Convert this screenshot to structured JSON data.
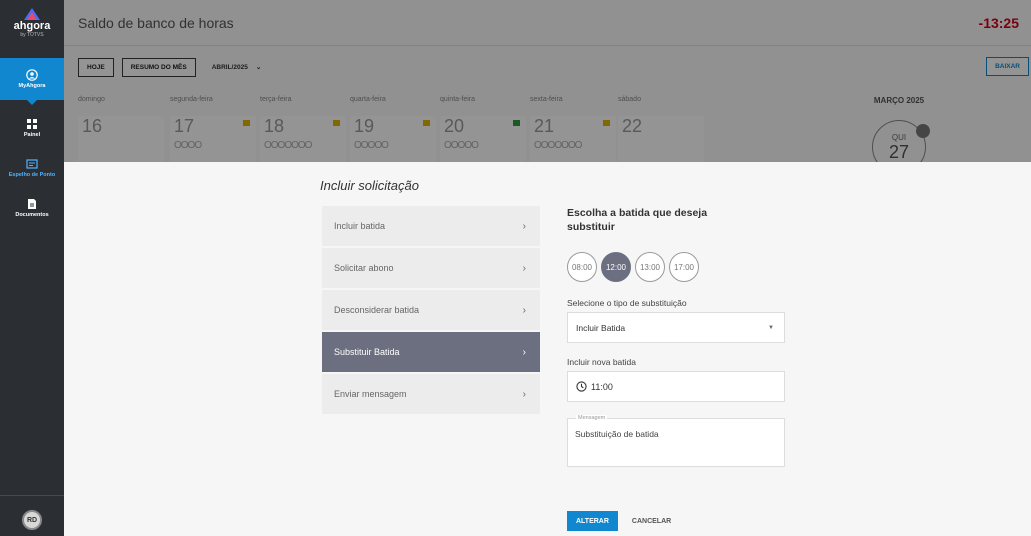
{
  "brand": {
    "name": "ahgora",
    "sub": "by TOTVS"
  },
  "sidebar": {
    "items": [
      {
        "label": "MyAhgora",
        "icon": "user-circle-icon",
        "active": true
      },
      {
        "label": "Painel",
        "icon": "dashboard-icon",
        "active": false
      },
      {
        "label": "Espelho de Ponto",
        "icon": "timesheet-icon",
        "active": false
      },
      {
        "label": "Documentos",
        "icon": "document-icon",
        "active": false
      }
    ],
    "avatar_initials": "RD"
  },
  "header": {
    "title": "Saldo de banco de horas",
    "balance": "-13:25"
  },
  "toolbar": {
    "today": "HOJE",
    "month_summary": "RESUMO DO MÊS",
    "period": "ABRIL/2025",
    "download": "BAIXAR"
  },
  "week": {
    "days": [
      {
        "name": "domingo",
        "num": "16",
        "flag": "",
        "dots": ""
      },
      {
        "name": "segunda-feira",
        "num": "17",
        "flag": "#e0b400",
        "dots": "OOOO"
      },
      {
        "name": "terça-feira",
        "num": "18",
        "flag": "#e0b400",
        "dots": "OOOOOOO"
      },
      {
        "name": "quarta-feira",
        "num": "19",
        "flag": "#e0b400",
        "dots": "OOOOO"
      },
      {
        "name": "quinta-feira",
        "num": "20",
        "flag": "#2e9e3e",
        "dots": "OOOOO"
      },
      {
        "name": "sexta-feira",
        "num": "21",
        "flag": "#e0b400",
        "dots": "OOOOOOO"
      },
      {
        "name": "sábado",
        "num": "22",
        "flag": "",
        "dots": ""
      }
    ]
  },
  "mini_calendar": {
    "title": "MARÇO 2025",
    "weekday": "QUI",
    "day": "27"
  },
  "panel": {
    "title": "Incluir solicitação",
    "menu": [
      {
        "label": "Incluir batida",
        "active": false
      },
      {
        "label": "Solicitar abono",
        "active": false
      },
      {
        "label": "Desconsiderar batida",
        "active": false
      },
      {
        "label": "Substituir Batida",
        "active": true
      },
      {
        "label": "Enviar mensagem",
        "active": false
      }
    ],
    "form": {
      "heading": "Escolha a batida que deseja substituir",
      "times": [
        "08:00",
        "12:00",
        "13:00",
        "17:00"
      ],
      "selected_time": "12:00",
      "substitution_label": "Selecione o tipo de substituição",
      "substitution_value": "Incluir Batida",
      "new_punch_label": "Incluir nova batida",
      "new_punch_value": "11:00",
      "message_label": "Mensagem",
      "message_value": "Substituição de batida",
      "submit": "ALTERAR",
      "cancel": "CANCELAR"
    }
  }
}
